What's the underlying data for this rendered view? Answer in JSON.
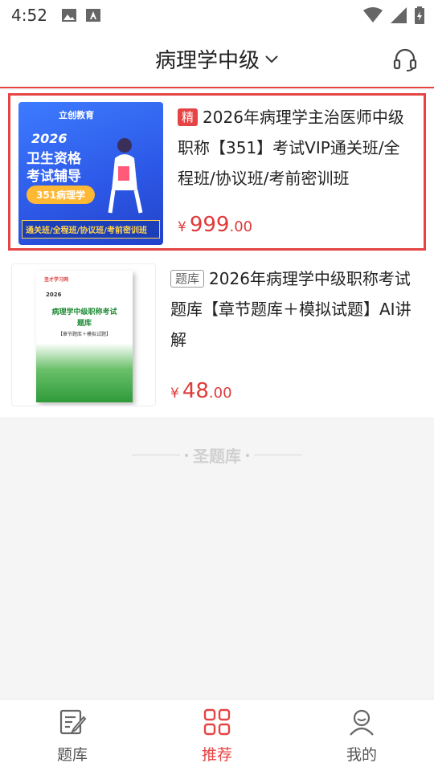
{
  "status_bar": {
    "time": "4:52"
  },
  "header": {
    "title": "病理学中级"
  },
  "products": [
    {
      "tag": "精",
      "title": "2026年病理学主治医师中级职称【351】考试VIP通关班/全程班/协议班/考前密训班",
      "price_symbol": "¥",
      "price_int": "999",
      "price_dec": ".00",
      "thumb": {
        "logo": "立创教育",
        "year": "2026",
        "line1": "卫生资格",
        "line2": "考试辅导",
        "pill": "351病理学",
        "bottom": "通关班/全程班/协议班/考前密训班"
      }
    },
    {
      "tag": "题库",
      "title": "2026年病理学中级职称考试题库【章节题库＋模拟试题】AI讲解",
      "price_symbol": "¥",
      "price_int": "48",
      "price_dec": ".00",
      "thumb": {
        "brand": "圣才学习网",
        "year": "2026",
        "title1": "病理学中级职称考试",
        "title2": "题库",
        "sub": "【章节题库＋模拟试题】"
      }
    }
  ],
  "divider_text": "圣题库",
  "nav": [
    {
      "label": "题库",
      "icon": "question-bank-icon",
      "active": false
    },
    {
      "label": "推荐",
      "icon": "grid-icon",
      "active": true
    },
    {
      "label": "我的",
      "icon": "user-icon",
      "active": false
    }
  ],
  "colors": {
    "accent": "#e64444",
    "price": "#e03a3a"
  }
}
